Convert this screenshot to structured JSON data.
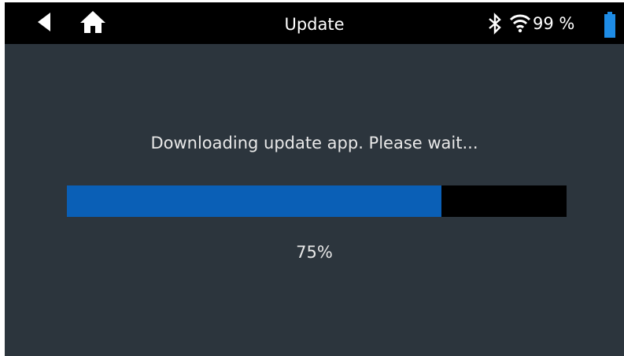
{
  "header": {
    "title": "Update",
    "back_icon": "back-arrow-icon",
    "home_icon": "home-icon"
  },
  "status_bar": {
    "bluetooth_icon": "bluetooth-icon",
    "wifi_icon": "wifi-icon",
    "battery_text": "99 %",
    "battery_icon": "battery-icon",
    "battery_color": "#1e8ce6"
  },
  "main": {
    "message": "Downloading update app. Please wait...",
    "progress_fraction": 0.75,
    "progress_text": "75%",
    "progress_fill_color": "#0a5fb6",
    "progress_track_color": "#000000"
  },
  "colors": {
    "background": "#2c353d",
    "topbar": "#000000",
    "text": "#e8e8e8"
  }
}
